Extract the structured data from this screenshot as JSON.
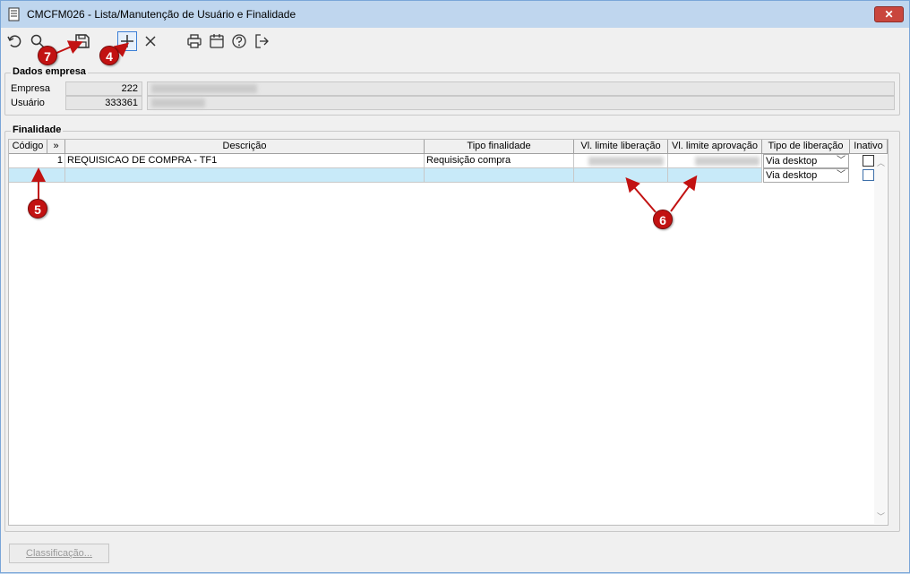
{
  "window": {
    "title": "CMCFM026 - Lista/Manutenção de Usuário e Finalidade",
    "close_label": "✕"
  },
  "toolbar": {
    "icons": [
      "undo-icon",
      "search-icon",
      "save-icon",
      "add-icon",
      "delete-icon",
      "print-icon",
      "calendar-icon",
      "help-icon",
      "exit-icon"
    ]
  },
  "empresa_group": {
    "title": "Dados empresa",
    "empresa_label": "Empresa",
    "empresa_code": "222",
    "usuario_label": "Usuário",
    "usuario_code": "333361"
  },
  "finalidade_group": {
    "title": "Finalidade",
    "columns": [
      "Código",
      "»",
      "Descrição",
      "Tipo finalidade",
      "Vl. limite liberação",
      "Vl. limite aprovação",
      "Tipo de liberação",
      "Inativo"
    ],
    "rows": [
      {
        "codigo": "1",
        "descricao": "REQUISICAO DE COMPRA - TF1",
        "tipo_finalidade": "Requisição compra",
        "tipo_liberacao": "Via desktop",
        "inativo": false
      },
      {
        "codigo": "",
        "descricao": "",
        "tipo_finalidade": "",
        "tipo_liberacao": "Via desktop",
        "inativo": false
      }
    ]
  },
  "footer": {
    "classificacao_label": "Classificação..."
  },
  "annotations": {
    "badge_7": "7",
    "badge_4": "4",
    "badge_5": "5",
    "badge_6": "6"
  },
  "colors": {
    "accent_red": "#c21212",
    "new_row": "#c8eaf9",
    "titlebar": "#bfd6ee"
  }
}
